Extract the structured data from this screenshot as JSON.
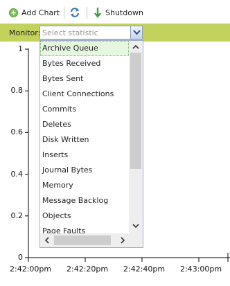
{
  "toolbar": {
    "add_chart_label": "Add Chart",
    "add_chart_icon": "plus-circle-icon",
    "refresh_icon": "refresh-icon",
    "shutdown_label": "Shutdown",
    "shutdown_icon": "down-arrow-icon"
  },
  "monitor": {
    "label": "Monitor:",
    "placeholder": "Select statistic"
  },
  "dropdown": {
    "items": [
      "Archive Queue",
      "Bytes Received",
      "Bytes Sent",
      "Client Connections",
      "Commits",
      "Deletes",
      "Disk Written",
      "Inserts",
      "Journal Bytes",
      "Memory",
      "Message Backlog",
      "Objects",
      "Page Faults"
    ],
    "selected": "Archive Queue"
  },
  "chart_data": {
    "type": "line",
    "title": "",
    "xlabel": "",
    "ylabel": "",
    "y_ticks": [
      "1",
      "0.8",
      "0.6",
      "0.4",
      "0.2",
      "0"
    ],
    "x_ticks": [
      "2:42:00pm",
      "2:42:20pm",
      "2:42:40pm",
      "2:43:00pm"
    ],
    "ylim": [
      0,
      1
    ],
    "series": []
  },
  "colors": {
    "monitor_bar": "#c3d25c",
    "selected_item": "#e6f7e0",
    "axis": "#000000"
  }
}
